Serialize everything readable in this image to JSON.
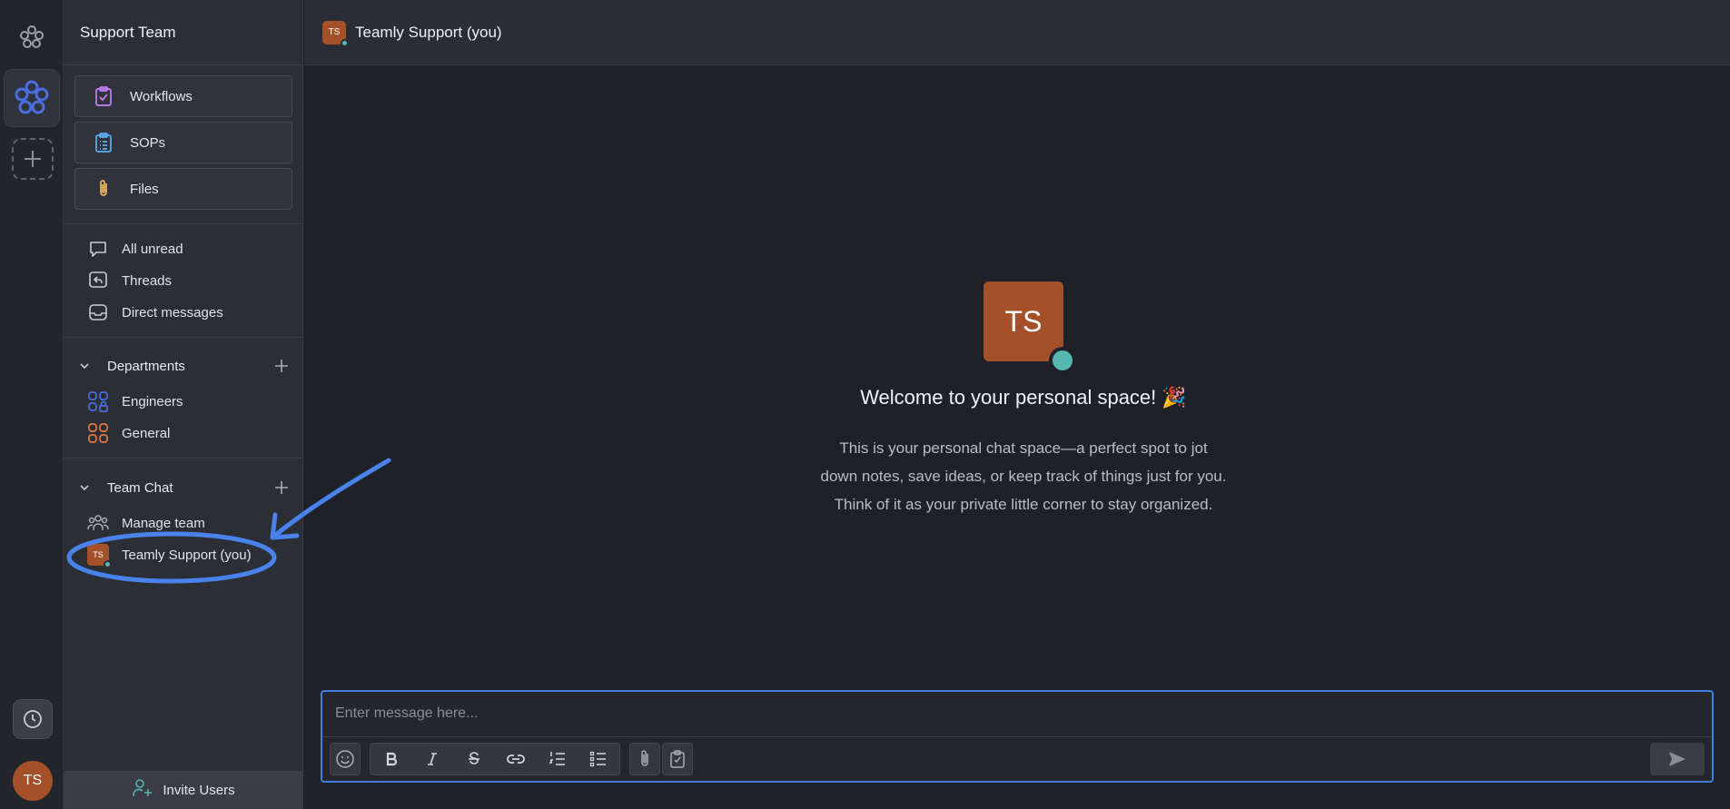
{
  "rail": {
    "avatar_initials": "TS"
  },
  "sidebar": {
    "team_name": "Support Team",
    "tools": [
      {
        "label": "Workflows",
        "icon": "clipboard-check-icon",
        "color": "#c77dff"
      },
      {
        "label": "SOPs",
        "icon": "clipboard-list-icon",
        "color": "#5ab0f0"
      },
      {
        "label": "Files",
        "icon": "paperclip-icon",
        "color": "#f0b860"
      }
    ],
    "nav": [
      {
        "label": "All unread",
        "icon": "chat-bubble-icon"
      },
      {
        "label": "Threads",
        "icon": "thread-reply-icon"
      },
      {
        "label": "Direct messages",
        "icon": "inbox-icon"
      }
    ],
    "departments": {
      "title": "Departments",
      "items": [
        {
          "label": "Engineers",
          "icon": "private-group-icon",
          "color": "#4a6ee0"
        },
        {
          "label": "General",
          "icon": "grid-group-icon",
          "color": "#e07a40"
        }
      ]
    },
    "team_chat": {
      "title": "Team Chat",
      "items": [
        {
          "label": "Manage team",
          "icon": "people-icon"
        },
        {
          "label": "Teamly Support (you)",
          "avatar_initials": "TS"
        }
      ]
    },
    "invite_label": "Invite Users"
  },
  "main": {
    "header_title": "Teamly Support (you)",
    "header_avatar": "TS",
    "welcome_avatar": "TS",
    "welcome_title": "Welcome to your personal space! 🎉",
    "welcome_lines": [
      "This is your personal chat space—a perfect spot to jot",
      "down notes, save ideas, or keep track of things just for you.",
      "Think of it as your private little corner to stay organized."
    ],
    "composer": {
      "placeholder": "Enter message here..."
    }
  },
  "colors": {
    "accent": "#3f7de0",
    "avatar": "#a4512a",
    "online": "#56b6b2",
    "annotation": "#4a82ec"
  }
}
